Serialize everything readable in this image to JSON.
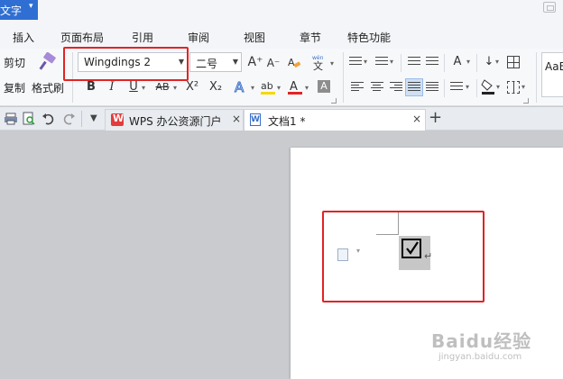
{
  "app": {
    "menu_label": "文字",
    "menu_caret": "▾"
  },
  "ribbon_tabs": [
    "插入",
    "页面布局",
    "引用",
    "审阅",
    "视图",
    "章节",
    "特色功能"
  ],
  "toolbar": {
    "cut_label": "剪切",
    "copy_label": "复制",
    "format_painter_label": "格式刷",
    "font_name": "Wingdings 2",
    "font_size": "二号",
    "grow_font": "A⁺",
    "shrink_font": "A⁻",
    "bold": "B",
    "italic": "I",
    "underline": "U",
    "strikethrough": "AB",
    "superscript": "X²",
    "subscript": "X₂",
    "pinyin": "文",
    "style_preview": "AaB"
  },
  "tabs": [
    {
      "label": "WPS 办公资源门户",
      "close": "×"
    },
    {
      "label": "文档1 *",
      "close": "×"
    }
  ],
  "add_tab": "+",
  "document": {
    "paragraph_mark": "↵",
    "checkbox_symbol": "checked-box"
  },
  "watermark": {
    "main": "Baidu经验",
    "sub": "jingyan.baidu.com"
  },
  "colors": {
    "accent": "#2f6fd3",
    "highlight_red": "#e02424",
    "font_color_bar": "#e02424",
    "highlight_bar": "#f5d90a"
  }
}
